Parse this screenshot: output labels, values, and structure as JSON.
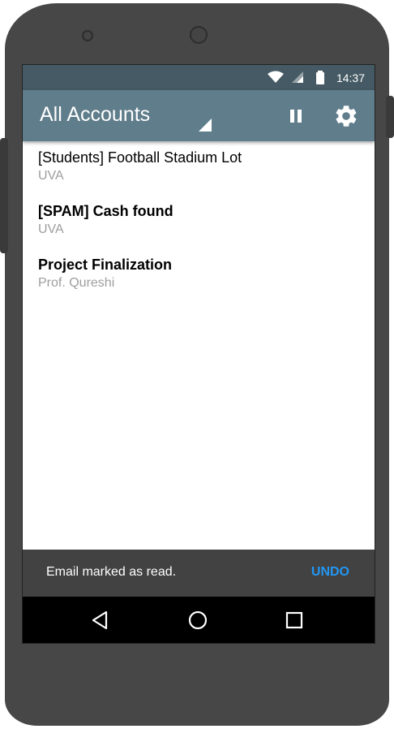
{
  "status_bar": {
    "time": "14:37",
    "icons": [
      "wifi-icon",
      "cell-signal-icon",
      "battery-icon"
    ]
  },
  "toolbar": {
    "title": "All Accounts",
    "icons": [
      "spinner-dropdown-icon",
      "pause-icon",
      "gear-icon"
    ]
  },
  "messages": [
    {
      "subject": "[Students] Football Stadium Lot",
      "sender": "UVA",
      "unread": false
    },
    {
      "subject": "[SPAM] Cash found",
      "sender": "UVA",
      "unread": true
    },
    {
      "subject": "Project Finalization",
      "sender": "Prof. Qureshi",
      "unread": true
    }
  ],
  "snackbar": {
    "text": "Email marked as read.",
    "action": "UNDO",
    "action_color": "#2196f3"
  },
  "nav_bar": {
    "icons": [
      "back-icon",
      "home-icon",
      "recents-icon"
    ]
  },
  "colors": {
    "status_bar": "#455a64",
    "toolbar": "#607d8b",
    "snackbar": "#424242",
    "device": "#474747"
  }
}
